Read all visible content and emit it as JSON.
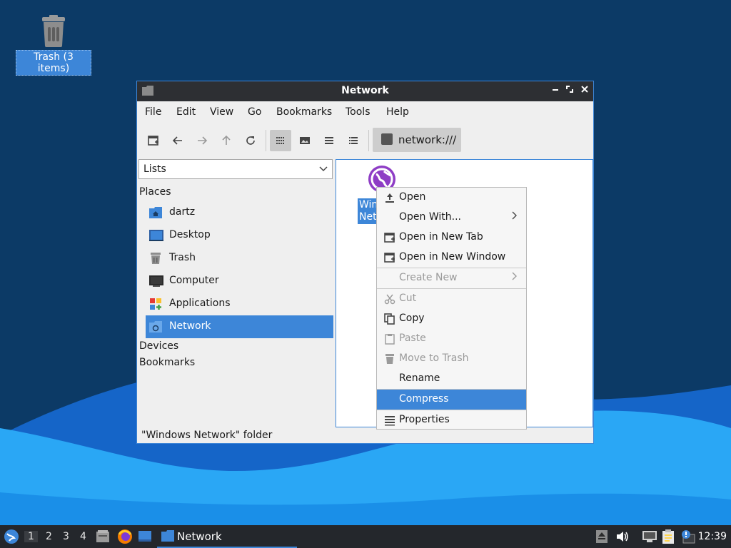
{
  "desktop": {
    "trash_label": "Trash (3 items)"
  },
  "window": {
    "title": "Network",
    "menu": [
      "File",
      "Edit",
      "View",
      "Go",
      "Bookmarks",
      "Tools",
      "Help"
    ],
    "location": "network:///",
    "side_panel_mode": "Lists",
    "places_header": "Places",
    "places": [
      "dartz",
      "Desktop",
      "Trash",
      "Computer",
      "Applications",
      "Network"
    ],
    "selected_place": "Network",
    "devices_header": "Devices",
    "bookmarks_header": "Bookmarks",
    "file_item_label_line1": "Win",
    "file_item_label_line2": "Net",
    "status": "\"Windows Network\" folder"
  },
  "context_menu": {
    "items": [
      {
        "label": "Open",
        "icon": "open-icon"
      },
      {
        "label": "Open With...",
        "icon": "",
        "submenu": true
      },
      {
        "label": "Open in New Tab",
        "icon": "new-tab-icon"
      },
      {
        "label": "Open in New Window",
        "icon": "new-window-icon"
      },
      {
        "label": "Create New",
        "icon": "",
        "submenu": true,
        "disabled": true
      },
      {
        "label": "Cut",
        "icon": "cut-icon",
        "disabled": true
      },
      {
        "label": "Copy",
        "icon": "copy-icon"
      },
      {
        "label": "Paste",
        "icon": "paste-icon",
        "disabled": true
      },
      {
        "label": "Move to Trash",
        "icon": "trash-icon",
        "disabled": true
      },
      {
        "label": "Rename",
        "icon": ""
      },
      {
        "label": "Compress",
        "icon": "",
        "highlighted": true
      },
      {
        "label": "Properties",
        "icon": "properties-icon"
      }
    ]
  },
  "taskbar": {
    "workspaces": [
      "1",
      "2",
      "3",
      "4"
    ],
    "active_workspace": "1",
    "task_label": "Network",
    "clock": "12:39"
  },
  "colors": {
    "accent": "#3d86d8",
    "titlebar": "#2d2f33",
    "taskbar": "#24272c",
    "desktop_dark": "#0c3a66",
    "wave_light": "#2aa7f5"
  }
}
